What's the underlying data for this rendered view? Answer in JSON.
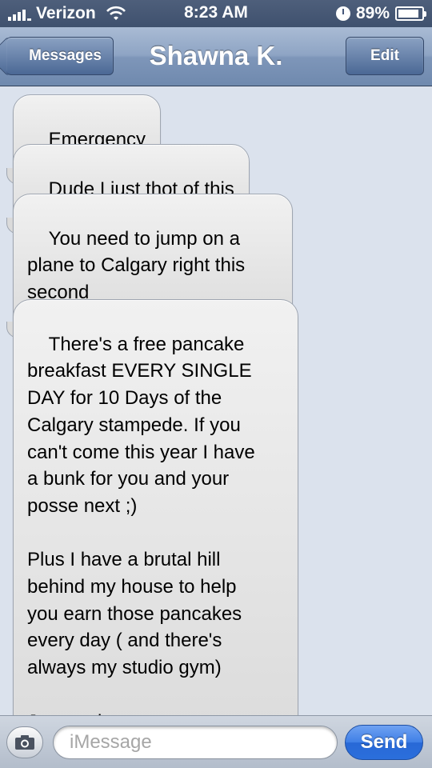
{
  "status_bar": {
    "carrier": "Verizon",
    "time": "8:23 AM",
    "battery": "89%",
    "battery_level": 0.89
  },
  "nav": {
    "back_label": "Messages",
    "title": "Shawna K.",
    "edit_label": "Edit"
  },
  "messages": [
    {
      "text": "Emergency"
    },
    {
      "text": "Dude I just thot of this"
    },
    {
      "text": "You need to jump on a\nplane to Calgary right this\nsecond"
    },
    {
      "text": "There's a free pancake\nbreakfast EVERY SINGLE\nDAY for 10 Days of the\nCalgary stampede. If you\ncan't come this year I have\na bunk for you and your\nposse next ;)\n\nPlus I have a brutal hill\nbehind my house to help\nyou earn those pancakes\nevery day ( and there's\nalways my studio gym)\n\nJust sayin..."
    }
  ],
  "input_bar": {
    "placeholder": "iMessage",
    "send_label": "Send"
  },
  "icons": {
    "camera": "camera-icon",
    "wifi": "wifi-icon",
    "signal": "signal-icon",
    "clock": "clock-icon",
    "battery": "battery-icon"
  }
}
